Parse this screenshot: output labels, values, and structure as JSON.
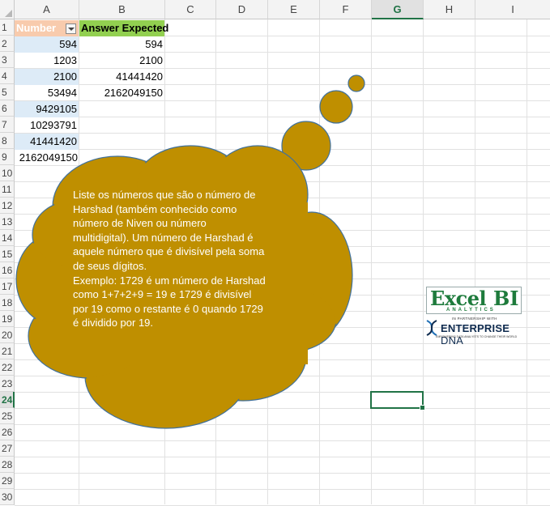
{
  "sheet": {
    "columns": [
      "A",
      "B",
      "C",
      "D",
      "E",
      "F",
      "G",
      "H",
      "I"
    ],
    "active_column": "G",
    "rows": [
      "1",
      "2",
      "3",
      "4",
      "5",
      "6",
      "7",
      "8",
      "9",
      "10",
      "11",
      "12",
      "13",
      "14",
      "15",
      "16",
      "17",
      "18",
      "19",
      "20",
      "21",
      "22",
      "23",
      "24",
      "25",
      "26",
      "27",
      "28",
      "29",
      "30"
    ],
    "active_row": "24",
    "headers": {
      "number": "Number",
      "answer": "Answer Expected"
    },
    "numbers": [
      "594",
      "1203",
      "2100",
      "53494",
      "9429105",
      "10293791",
      "41441420",
      "2162049150"
    ],
    "answers": [
      "594",
      "2100",
      "41441420",
      "2162049150"
    ]
  },
  "callout": {
    "lines": [
      "Liste os números que são o número de",
      "Harshad (também conhecido como",
      "número de Niven ou número",
      "multidigital). Um número de Harshad é",
      "aquele número que é divisível pela soma",
      "de seus dígitos.",
      "Exemplo: 1729 é um número de Harshad",
      "como 1+7+2+9 = 19 e 1729 é divisível",
      "por 19 como o restante é 0 quando 1729",
      "é dividido por 19."
    ],
    "fill": "#bf8f00",
    "stroke": "#41719c"
  },
  "logo": {
    "excel": "Excel",
    "bi": "BI",
    "analytics": "ANALYTICS",
    "partner": "IN PARTNERSHIP WITH",
    "enterprise": "ENTERPRISE",
    "dna": "DNA",
    "tagline": "EMPOWERING DATA ANALYSTS TO CHANGE THEIR WORLD"
  }
}
